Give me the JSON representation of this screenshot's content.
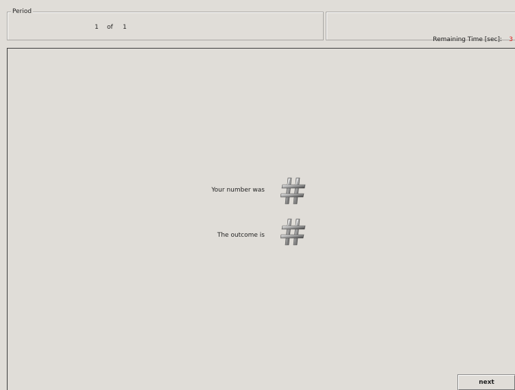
{
  "header": {
    "period_title": "Period",
    "period_current": "1",
    "period_of": "of",
    "period_total": "1",
    "remaining_label": "Remaining Time [sec]:",
    "remaining_value": "3",
    "remaining_value_color": "#e02020"
  },
  "main": {
    "number_label": "Your number was",
    "number_icon": "hash-icon",
    "outcome_label": "The outcome is",
    "outcome_icon": "hash-icon"
  },
  "footer": {
    "next_label": "next"
  }
}
